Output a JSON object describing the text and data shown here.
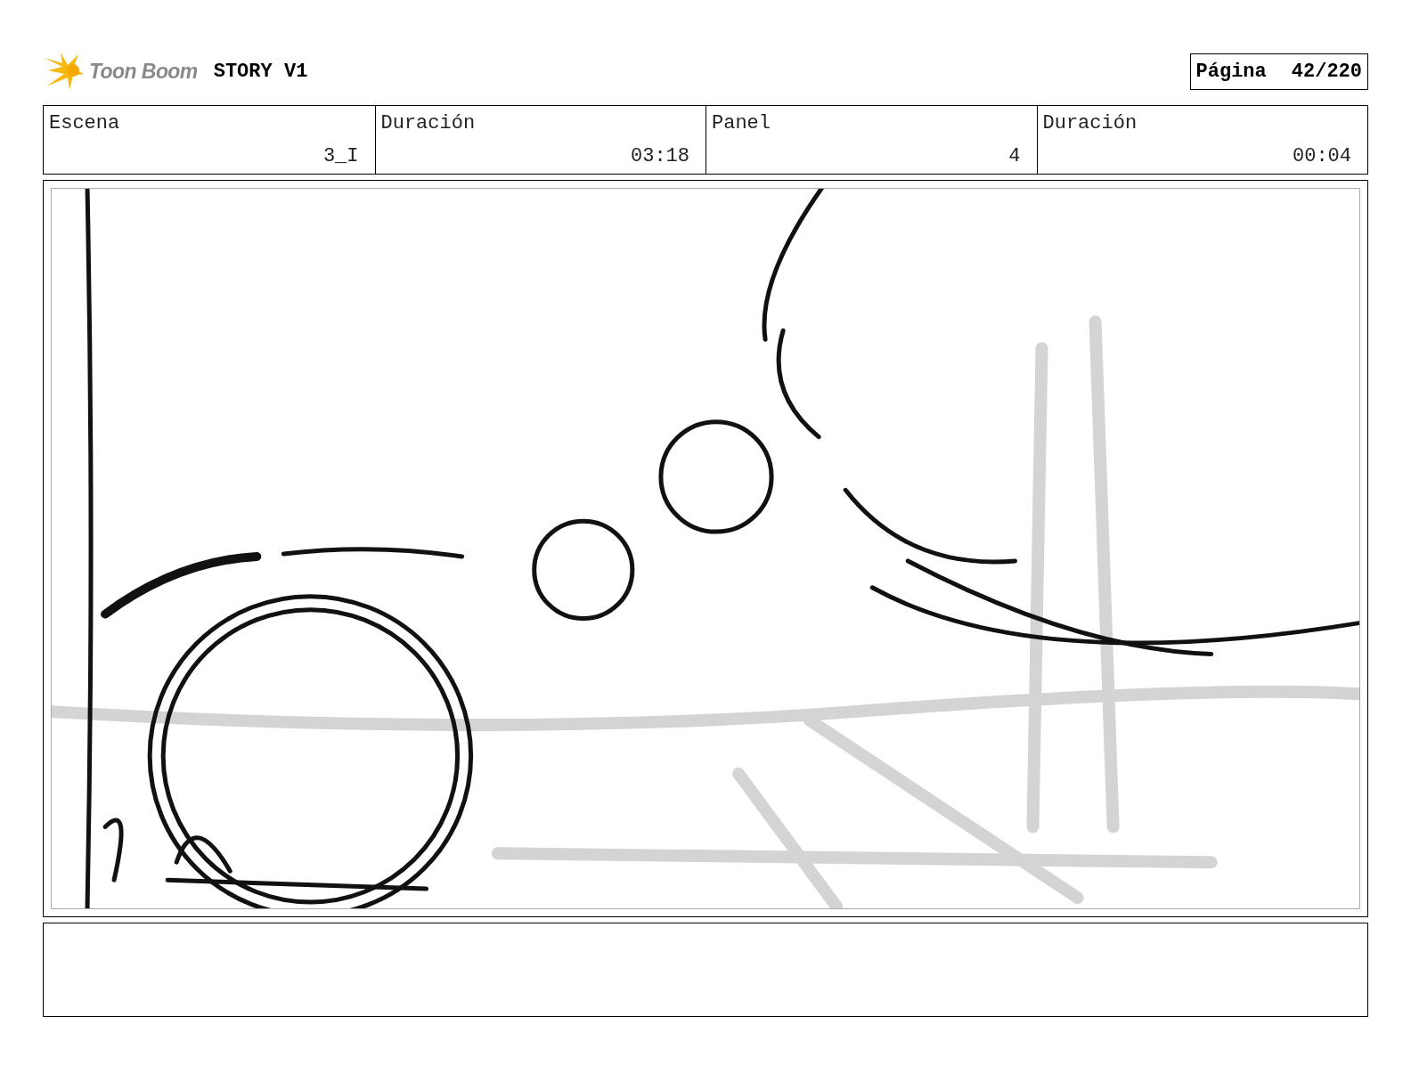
{
  "header": {
    "logo_text": "Toon Boom",
    "title": "STORY V1",
    "page_label": "Página",
    "page_number": "42/220"
  },
  "fields": [
    {
      "label": "Escena",
      "value": "3_I"
    },
    {
      "label": "Duración",
      "value": "03:18"
    },
    {
      "label": "Panel",
      "value": "4"
    },
    {
      "label": "Duración",
      "value": "00:04"
    }
  ]
}
